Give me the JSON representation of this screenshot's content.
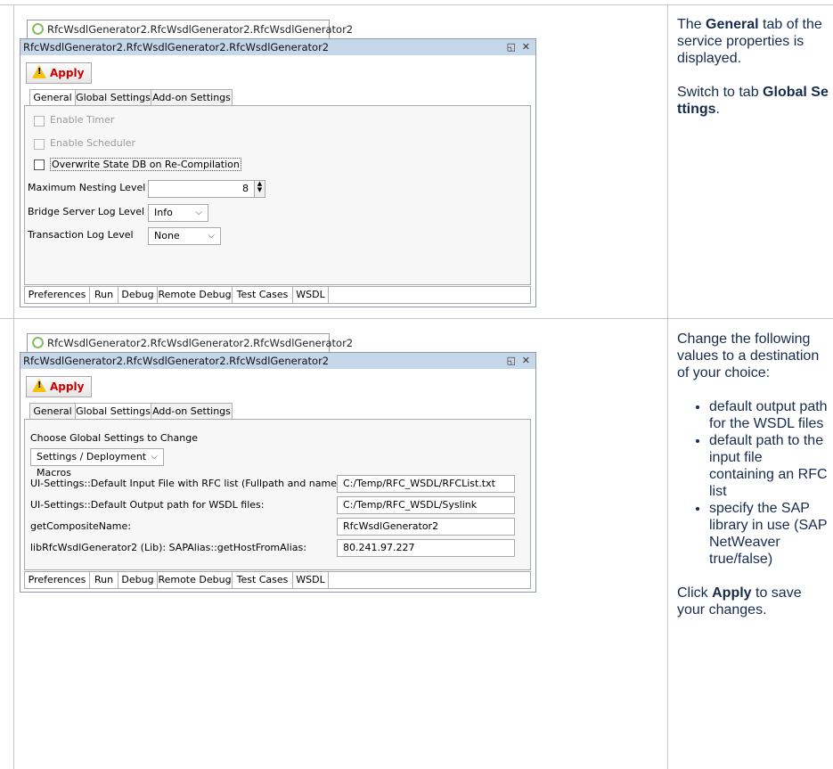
{
  "row1": {
    "window_tab_title": "RfcWsdlGenerator2.RfcWsdlGenerator2.RfcWsdlGenerator2",
    "titlebar_text": "RfcWsdlGenerator2.RfcWsdlGenerator2.RfcWsdlGenerator2",
    "apply_label": "Apply",
    "tabs": [
      "General",
      "Global Settings",
      "Add-on Settings"
    ],
    "active_tab": "General",
    "checkboxes": [
      {
        "label": "Enable Timer",
        "enabled": false
      },
      {
        "label": "Enable Scheduler",
        "enabled": false
      },
      {
        "label": "Overwrite State DB on Re-Compilation",
        "enabled": true
      }
    ],
    "fields": {
      "max_nesting_label": "Maximum Nesting Level",
      "max_nesting_value": "8",
      "bridge_log_label": "Bridge Server Log Level",
      "bridge_log_value": "Info",
      "transaction_log_label": "Transaction Log Level",
      "transaction_log_value": "None"
    },
    "bottom_tabs": [
      "Preferences",
      "Run",
      "Debug",
      "Remote Debug",
      "Test Cases",
      "WSDL"
    ],
    "description_1_pre": "The ",
    "description_1_bold": "General",
    "description_1_post": " tab of the service properties is displayed.",
    "description_2_pre": "Switch to tab ",
    "description_2_bold": "Global Settings",
    "description_2_post": "."
  },
  "row2": {
    "window_tab_title": "RfcWsdlGenerator2.RfcWsdlGenerator2.RfcWsdlGenerator2",
    "titlebar_text": "RfcWsdlGenerator2.RfcWsdlGenerator2.RfcWsdlGenerator2",
    "apply_label": "Apply",
    "tabs": [
      "General",
      "Global Settings",
      "Add-on Settings"
    ],
    "active_tab": "Global Settings",
    "choose_label": "Choose Global Settings to Change",
    "choose_value": "Settings / Deployment Macros",
    "settings": [
      {
        "label": "UI-Settings::Default Input File with RFC list (Fullpath and name):",
        "value": "C:/Temp/RFC_WSDL/RFCList.txt"
      },
      {
        "label": "UI-Settings::Default Output path for WSDL files:",
        "value": "C:/Temp/RFC_WSDL/Syslink"
      },
      {
        "label": "getCompositeName:",
        "value": "RfcWsdlGenerator2"
      },
      {
        "label": "libRfcWsdlGenerator2 (Lib): SAPAlias::getHostFromAlias:",
        "value": "80.241.97.227"
      }
    ],
    "bottom_tabs": [
      "Preferences",
      "Run",
      "Debug",
      "Remote Debug",
      "Test Cases",
      "WSDL"
    ],
    "intro_text": "Change the following values to a destination of your choice:",
    "bullets": [
      "default output path for the WSDL files",
      "default path to the input file containing an RFC list",
      "specify the SAP library in use (SAP NetWeaver true/false)"
    ],
    "click_pre": "Click ",
    "click_bold": "Apply",
    "click_post": " to save your changes."
  },
  "icons": {
    "window_tab_icon": "service-icon",
    "maximize_icon": "restore-icon",
    "close_icon": "close-icon",
    "warning_icon": "warning-icon"
  }
}
